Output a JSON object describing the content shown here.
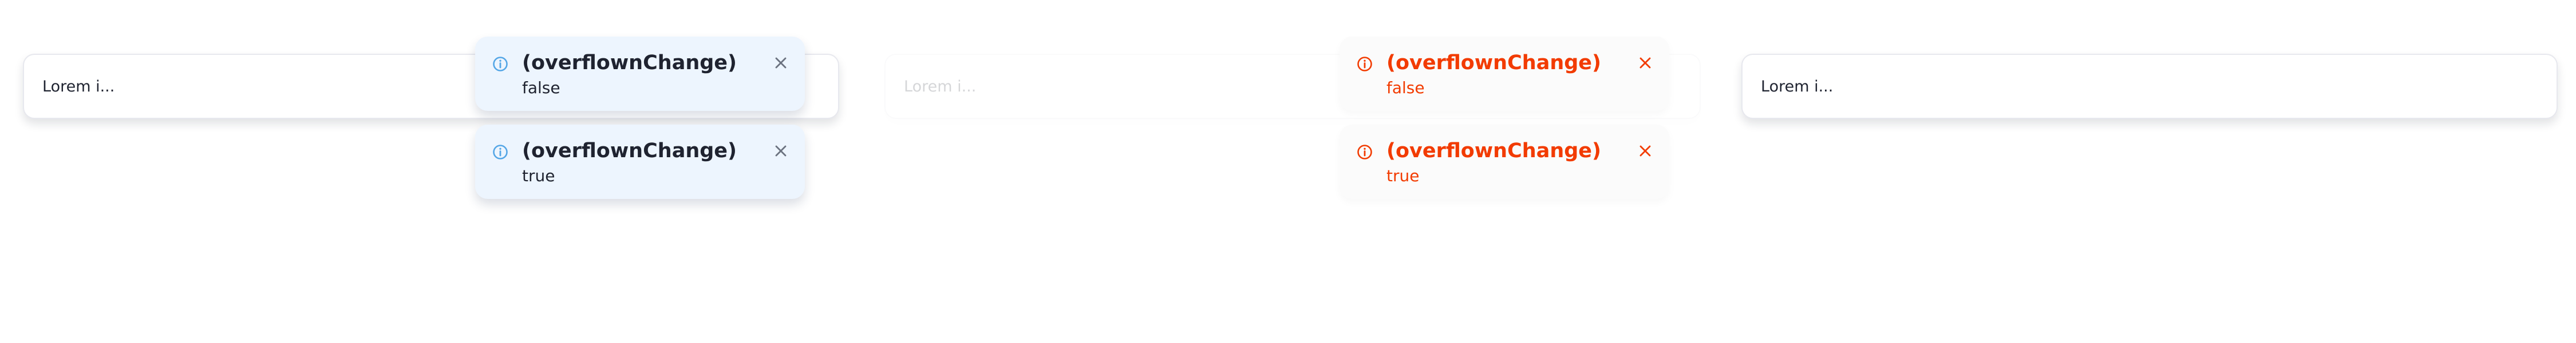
{
  "colors": {
    "info_icon": "#54a6e6",
    "danger_accent": "#f23b00",
    "close_gray": "#6b7280"
  },
  "boxes": [
    {
      "text": "Lorem i..."
    },
    {
      "text": "Lorem i..."
    },
    {
      "text": "Lorem i..."
    }
  ],
  "toasts": {
    "info": [
      {
        "icon": "info-icon",
        "title": "(overflownChange)",
        "body": "false"
      },
      {
        "icon": "info-icon",
        "title": "(overflownChange)",
        "body": "true"
      }
    ],
    "danger": [
      {
        "icon": "info-icon",
        "title": "(overflownChange)",
        "body": "false"
      },
      {
        "icon": "info-icon",
        "title": "(overflownChange)",
        "body": "true"
      }
    ]
  }
}
